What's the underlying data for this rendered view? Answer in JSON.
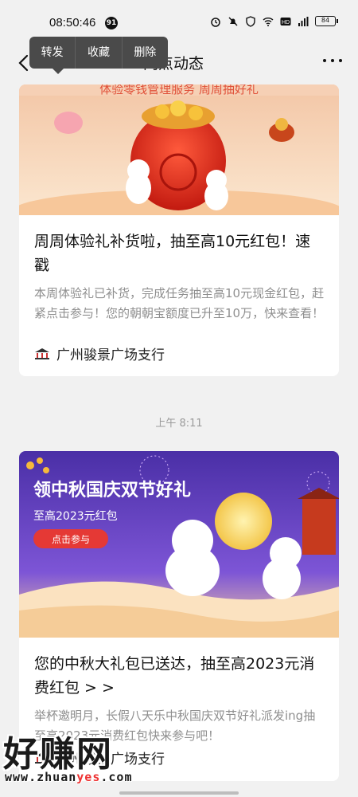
{
  "status_bar": {
    "time": "08:50:46",
    "notification_count": "91",
    "battery": "84"
  },
  "nav": {
    "title": "网点动态"
  },
  "context_menu": {
    "items": [
      "转发",
      "收藏",
      "删除"
    ]
  },
  "cards": [
    {
      "banner_text": "体验零钱管理服务 周周抽好礼",
      "title": "周周体验礼补货啦，抽至高10元红包！速戳",
      "description": "本周体验礼已补货，完成任务抽至高10元现金红包，赶紧点击参与！您的朝朝宝额度已升至10万，快来查看！",
      "branch": "广州骏景广场支行"
    },
    {
      "banner_headline": "领中秋国庆双节好礼",
      "banner_sub": "至高2023元红包",
      "banner_button": "点击参与",
      "title": "您的中秋大礼包已送达，抽至高2023元消费红包 > >",
      "description": "举杯邀明月，长假八天乐中秋国庆双节好礼派发ing抽至高2023元消费红包快来参与吧！",
      "branch": "广州骏景广场支行"
    }
  ],
  "time_separator": "上午 8:11",
  "watermark": {
    "big": "好赚网",
    "url_prefix": "www.zhuan",
    "url_highlight": "yes",
    "url_suffix": ".com"
  },
  "colors": {
    "banner1_bg": "#f7d9b8",
    "banner2_bg": "#5b3fb0",
    "accent_red": "#e53935"
  }
}
